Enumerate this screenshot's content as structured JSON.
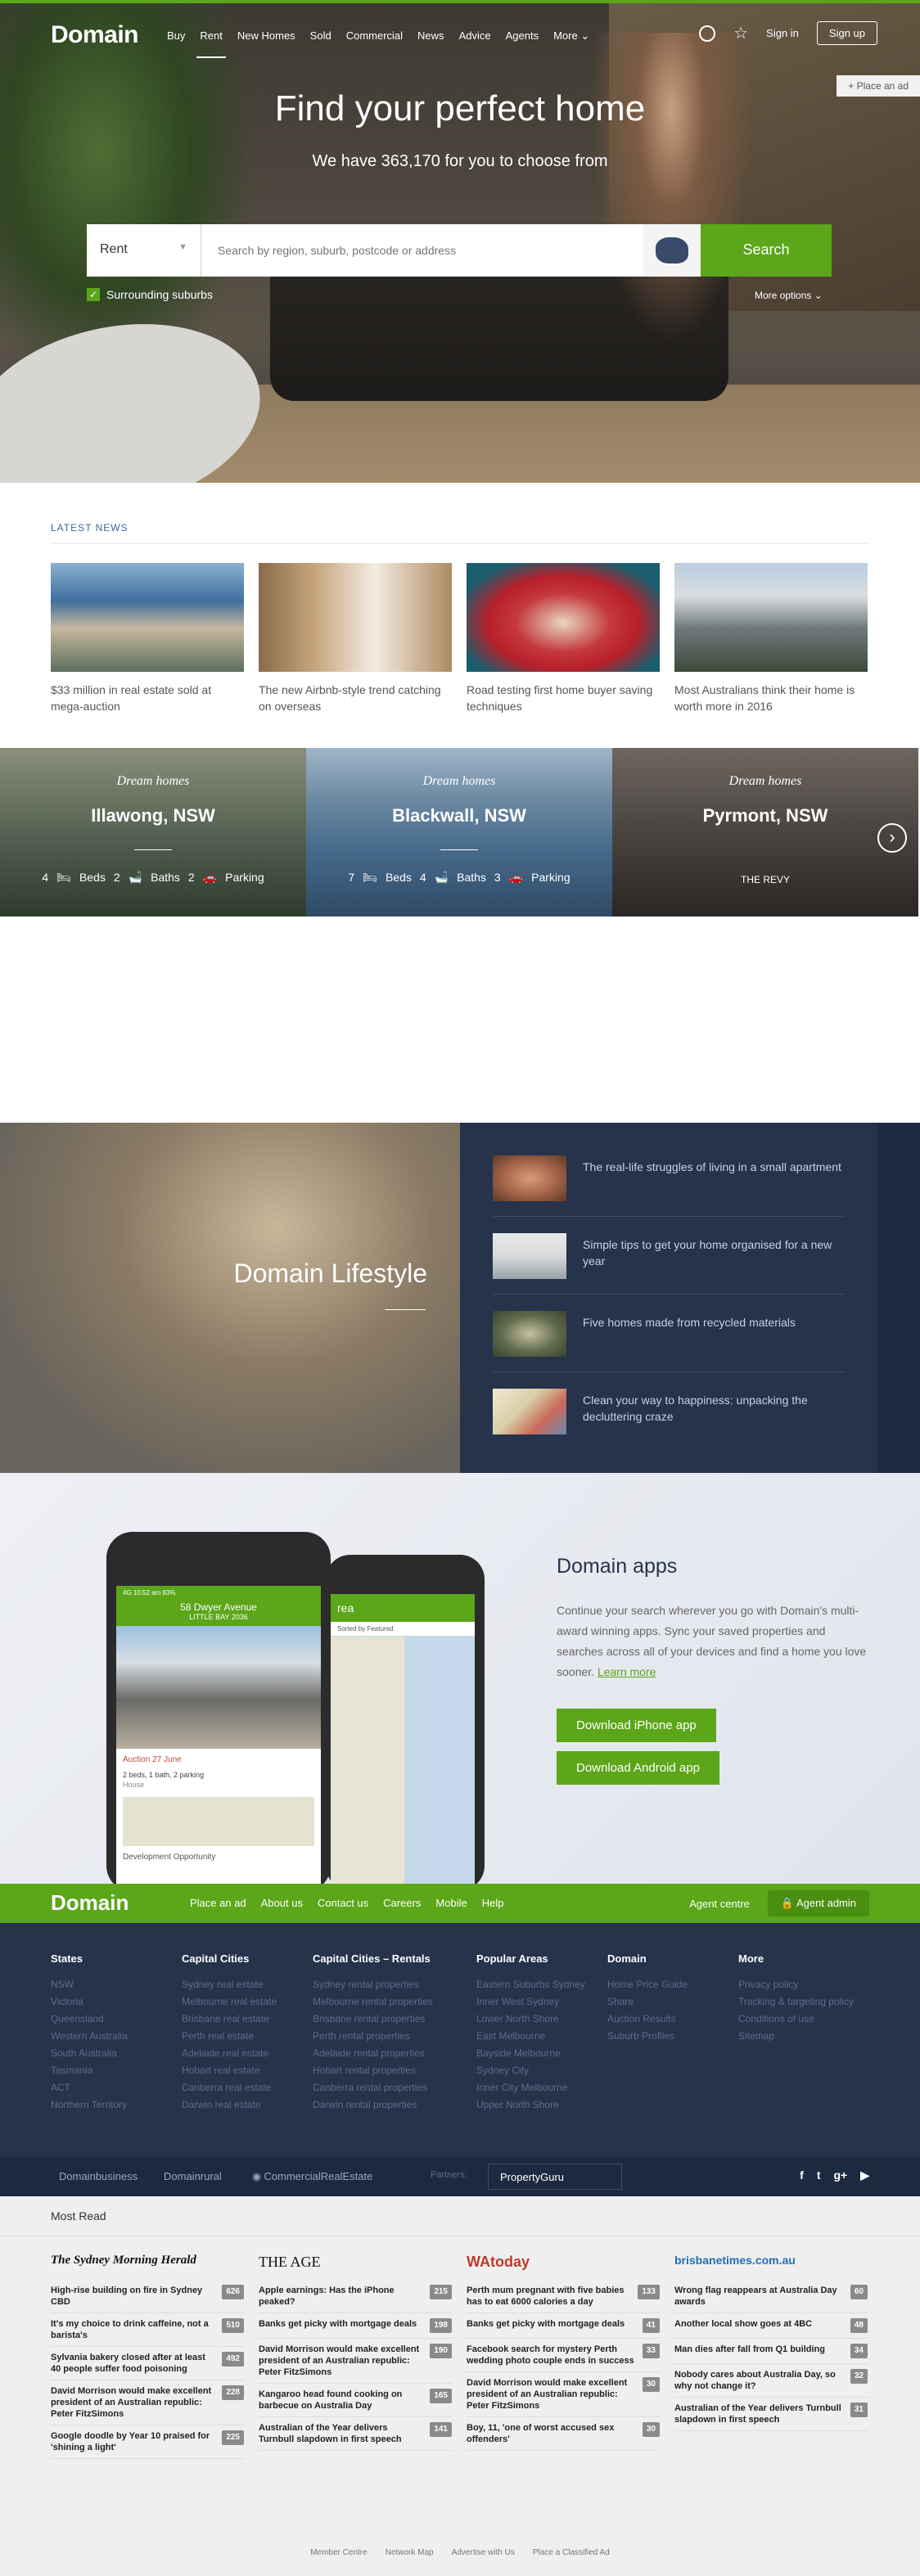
{
  "nav": {
    "logo": "Domain",
    "links": [
      "Buy",
      "Rent",
      "New Homes",
      "Sold",
      "Commercial",
      "News",
      "Advice",
      "Agents",
      "More"
    ],
    "sign_in": "Sign in",
    "sign_up": "Sign up",
    "place_ad": "+ Place an ad"
  },
  "hero": {
    "title": "Find your perfect home",
    "subtitle": "We have 363,170 for you to choose from",
    "search_type": "Rent",
    "search_placeholder": "Search by region, suburb, postcode or address",
    "search_button": "Search",
    "surrounding": "Surrounding suburbs",
    "more_options": "More options"
  },
  "news": {
    "heading": "LATEST NEWS",
    "items": [
      {
        "title": "$33 million in real estate sold at mega-auction",
        "color": "#3f6f9f"
      },
      {
        "title": "The new Airbnb-style trend catching on overseas",
        "color": "#c8a77f"
      },
      {
        "title": "Road testing first home buyer saving techniques",
        "color": "#b8202a"
      },
      {
        "title": "Most Australians think their home is worth more in 2016",
        "color": "#6f7a7d"
      }
    ]
  },
  "dream": {
    "label": "Dream homes",
    "cards": [
      {
        "name": "Illawong, NSW",
        "beds": "4",
        "beds_label": "Beds",
        "baths": "2",
        "baths_label": "Baths",
        "parking": "2",
        "parking_label": "Parking",
        "tag": "",
        "color": "#4d5a4b"
      },
      {
        "name": "Blackwall, NSW",
        "beds": "7",
        "beds_label": "Beds",
        "baths": "4",
        "baths_label": "Baths",
        "parking": "3",
        "parking_label": "Parking",
        "tag": "",
        "color": "#476b8c"
      },
      {
        "name": "Pyrmont, NSW",
        "beds": "",
        "beds_label": "",
        "baths": "",
        "baths_label": "",
        "parking": "",
        "parking_label": "",
        "tag": "THE REVY",
        "color": "#4a4440"
      }
    ]
  },
  "lifestyle": {
    "title": "Domain Lifestyle",
    "items": [
      {
        "title": "The real-life struggles of living in a small apartment",
        "color": "#a8664a"
      },
      {
        "title": "Simple tips to get your home organised for a new year",
        "color": "#d8dadc"
      },
      {
        "title": "Five homes made from recycled materials",
        "color": "#5f6b4c"
      },
      {
        "title": "Clean your way to happiness: unpacking the decluttering craze",
        "color": "#d9cfa8"
      }
    ]
  },
  "apps": {
    "title": "Domain apps",
    "body": "Continue your search wherever you go with Domain's multi-award winning apps. Sync your saved properties and searches across all of your devices and find a home you love sooner.",
    "learn": "Learn more",
    "iphone": "Download iPhone app",
    "android": "Download Android app",
    "phone1": {
      "status": "4G  10:52 am  83%",
      "address": "58 Dwyer Avenue",
      "suburb": "LITTLE BAY 2036",
      "auction": "Auction 27 June",
      "specs": "2 beds, 1 bath, 2 parking",
      "type": "House",
      "headline": "Development Opportunity"
    },
    "phone2": {
      "title": "rea",
      "sort": "Sorted by Featured"
    }
  },
  "footer": {
    "logo": "Domain",
    "links": [
      "Place an ad",
      "About us",
      "Contact us",
      "Careers",
      "Mobile",
      "Help"
    ],
    "agent_centre": "Agent centre",
    "agent_admin": "Agent admin",
    "columns": [
      {
        "title": "States",
        "items": [
          "NSW",
          "Victoria",
          "Queensland",
          "Western Australia",
          "South Australia",
          "Tasmania",
          "ACT",
          "Northern Territory"
        ]
      },
      {
        "title": "Capital Cities",
        "items": [
          "Sydney real estate",
          "Melbourne real estate",
          "Brisbane real estate",
          "Perth real estate",
          "Adelaide real estate",
          "Hobart real estate",
          "Canberra real estate",
          "Darwin real estate"
        ]
      },
      {
        "title": "Capital Cities – Rentals",
        "items": [
          "Sydney rental properties",
          "Melbourne rental properties",
          "Brisbane rental properties",
          "Perth rental properties",
          "Adelaide rental properties",
          "Hobart rental properties",
          "Canberra rental properties",
          "Darwin rental properties"
        ]
      },
      {
        "title": "Popular Areas",
        "items": [
          "Eastern Suburbs Sydney",
          "Inner West Sydney",
          "Lower North Shore",
          "East Melbourne",
          "Bayside Melbourne",
          "Sydney City",
          "Inner City Melbourne",
          "Upper North Shore"
        ]
      },
      {
        "title": "Domain",
        "items": [
          "Home Price Guide",
          "Share",
          "Auction Results",
          "Suburb Profiles"
        ]
      },
      {
        "title": "More",
        "items": [
          "Privacy policy",
          "Tracking & targeting policy",
          "Conditions of use",
          "Sitemap"
        ]
      }
    ],
    "brands": [
      "Domainbusiness",
      "Domainrural",
      "CommercialRealEstate"
    ],
    "partners_label": "Partners:",
    "partner": "PropertyGuru",
    "social": [
      "f",
      "t",
      "g+",
      "▶"
    ]
  },
  "mostread": {
    "heading": "Most Read",
    "columns": [
      {
        "brand": "The Sydney Morning Herald",
        "items": [
          [
            "High-rise building on fire in Sydney CBD",
            "626"
          ],
          [
            "It's my choice to drink caffeine, not a barista's",
            "510"
          ],
          [
            "Sylvania bakery closed after at least 40 people suffer food poisoning",
            "492"
          ],
          [
            "David Morrison would make excellent president of an Australian republic: Peter FitzSimons",
            "228"
          ],
          [
            "Google doodle by Year 10 praised for 'shining a light'",
            "225"
          ]
        ]
      },
      {
        "brand": "THE AGE",
        "items": [
          [
            "Apple earnings: Has the iPhone peaked?",
            "215"
          ],
          [
            "Banks get picky with mortgage deals",
            "198"
          ],
          [
            "David Morrison would make excellent president of an Australian republic: Peter FitzSimons",
            "190"
          ],
          [
            "Kangaroo head found cooking on barbecue on Australia Day",
            "165"
          ],
          [
            "Australian of the Year delivers Turnbull slapdown in first speech",
            "141"
          ]
        ]
      },
      {
        "brand": "WAtoday",
        "items": [
          [
            "Perth mum pregnant with five babies has to eat 6000 calories a day",
            "133"
          ],
          [
            "Banks get picky with mortgage deals",
            "41"
          ],
          [
            "Facebook search for mystery Perth wedding photo couple ends in success",
            "33"
          ],
          [
            "David Morrison would make excellent president of an Australian republic: Peter FitzSimons",
            "30"
          ],
          [
            "Boy, 11, 'one of worst accused sex offenders'",
            "30"
          ]
        ]
      },
      {
        "brand": "brisbanetimes.com.au",
        "items": [
          [
            "Wrong flag reappears at Australia Day awards",
            "60"
          ],
          [
            "Another local show goes at 4BC",
            "48"
          ],
          [
            "Man dies after fall from Q1 building",
            "34"
          ],
          [
            "Nobody cares about Australia Day, so why not change it?",
            "32"
          ],
          [
            "Australian of the Year delivers Turnbull slapdown in first speech",
            "31"
          ]
        ]
      }
    ],
    "bottom": [
      "Member Centre",
      "Network Map",
      "Advertise with Us",
      "Place a Classified Ad"
    ]
  }
}
